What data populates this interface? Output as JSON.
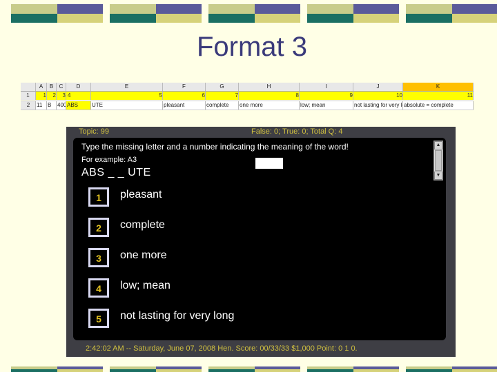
{
  "slide": {
    "title": "Format 3"
  },
  "sheet": {
    "columns": [
      "A",
      "B",
      "C",
      "D",
      "E",
      "F",
      "G",
      "H",
      "I",
      "J",
      "K"
    ],
    "row_numbers": [
      "1",
      "2"
    ],
    "row1": [
      "1",
      "2",
      "3",
      "4",
      "",
      "5",
      "6",
      "7",
      "8",
      "9",
      "10",
      "11"
    ],
    "row2": [
      "11",
      "B",
      "400",
      "ABS",
      "UTE",
      "pleasant",
      "complete",
      "one more",
      "low; mean",
      "not lasting for very long",
      "absolute = complete"
    ]
  },
  "app": {
    "topic_label": "Topic: 99",
    "tally_label": "False: 0; True: 0; Total Q: 4",
    "instruction": "Type the missing letter and a number indicating the meaning of the word!",
    "example": "For example: A3",
    "word": "ABS _  _ UTE",
    "answer_value": "",
    "options": [
      {
        "number": "1",
        "text": "pleasant"
      },
      {
        "number": "2",
        "text": "complete"
      },
      {
        "number": "3",
        "text": "one more"
      },
      {
        "number": "4",
        "text": "low; mean"
      },
      {
        "number": "5",
        "text": "not lasting for very long"
      }
    ],
    "status": "2:42:02 AM -- Saturday, June 07, 2008    Hen.  Score:  00/33/33   $1,000  Point: 0 1 0."
  },
  "colors": {
    "background": "#ffffe6",
    "title": "#3a3a7a",
    "status_text": "#d0c040",
    "option_number": "#e0c020",
    "highlight_row": "#ffff00",
    "selected_cell": "#ffc000"
  },
  "icons": {
    "scroll_up": "scroll-up-arrow-icon",
    "scroll_down": "scroll-down-arrow-icon"
  }
}
